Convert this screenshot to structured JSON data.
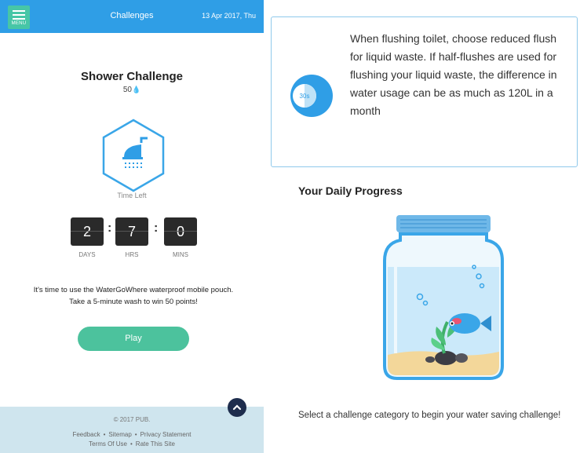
{
  "header": {
    "menu_label": "MENU",
    "title": "Challenges",
    "date": "13 Apr 2017, Thu"
  },
  "challenge": {
    "name": "Shower Challenge",
    "points": "50",
    "icon": "shower-icon",
    "time_left_label": "Time Left",
    "countdown": {
      "days": "2",
      "hrs": "7",
      "mins": "0",
      "days_label": "DAYS",
      "hrs_label": "HRS",
      "mins_label": "MINS"
    },
    "message_line1": "It's time to use the WaterGoWhere waterproof mobile pouch.",
    "message_line2": "Take a 5-minute wash to win 50 points!",
    "play_label": "Play"
  },
  "footer": {
    "copyright": "© 2017 PUB.",
    "links": [
      "Feedback",
      "Sitemap",
      "Privacy Statement",
      "Terms Of Use",
      "Rate This Site"
    ],
    "separator": "•"
  },
  "tip": {
    "badge": "30s",
    "text": "When flushing toilet, choose reduced flush for liquid waste. If half-flushes are used for flushing your liquid waste, the difference in water usage can be as much as 120L in a month"
  },
  "progress": {
    "title": "Your Daily Progress",
    "illustration": "fish-jar-icon",
    "instruction": "Select a challenge category to begin your water saving challenge!"
  },
  "colors": {
    "header_blue": "#2f9ee6",
    "menu_green": "#47c6a6",
    "play_green": "#4cc29d",
    "footer_bg": "#cfe5ee",
    "up_button": "#1e2d4d",
    "card_border": "#8fc9eb"
  }
}
